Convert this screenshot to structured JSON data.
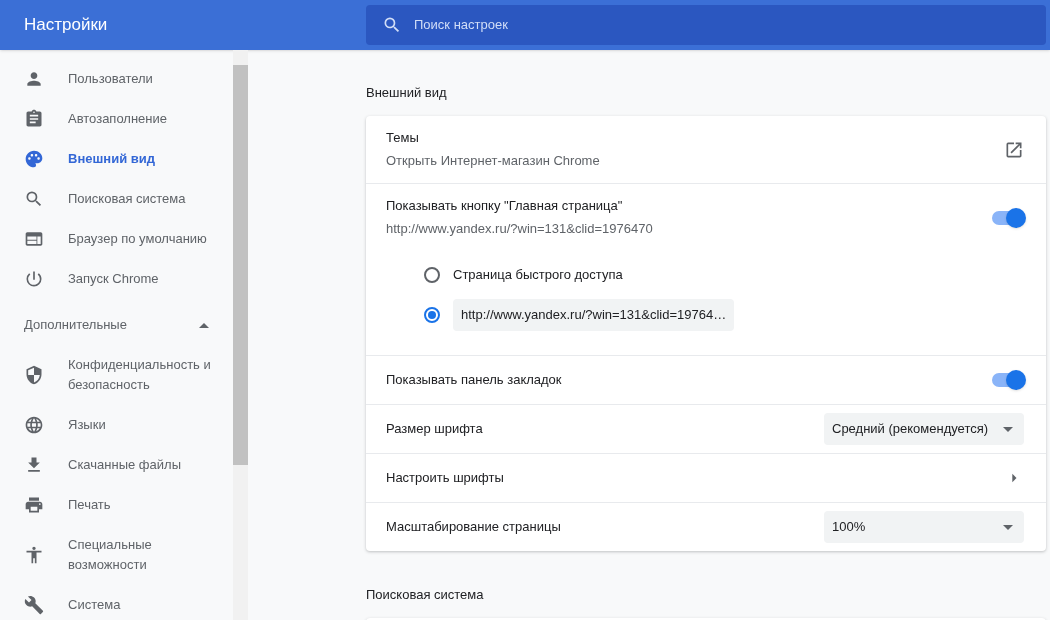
{
  "header": {
    "title": "Настройки",
    "search": {
      "placeholder": "Поиск настроек"
    }
  },
  "sidebar": {
    "items": [
      {
        "label": "Пользователи",
        "selected": false
      },
      {
        "label": "Автозаполнение",
        "selected": false
      },
      {
        "label": "Внешний вид",
        "selected": true
      },
      {
        "label": "Поисковая система",
        "selected": false
      },
      {
        "label": "Браузер по умолчанию",
        "selected": false
      },
      {
        "label": "Запуск Chrome",
        "selected": false
      }
    ],
    "advanced": {
      "label": "Дополнительные",
      "expanded": true,
      "items": [
        {
          "label": "Конфиденциальность и безопасность",
          "selected": false
        },
        {
          "label": "Языки",
          "selected": false
        },
        {
          "label": "Скачанные файлы",
          "selected": false
        },
        {
          "label": "Печать",
          "selected": false
        },
        {
          "label": "Специальные возможности",
          "selected": false
        },
        {
          "label": "Система",
          "selected": false
        }
      ]
    }
  },
  "sections": [
    {
      "title": "Внешний вид",
      "rows": [
        {
          "kind": "link",
          "label": "Темы",
          "sublabel": "Открыть Интернет-магазин Chrome"
        },
        {
          "kind": "toggle",
          "label": "Показывать кнопку \"Главная страница\"",
          "sublabel": "http://www.yandex.ru/?win=131&clid=1976470",
          "on": true,
          "options": [
            {
              "kind": "text",
              "label": "Страница быстрого доступа",
              "selected": false
            },
            {
              "kind": "field",
              "value": "http://www.yandex.ru/?win=131&clid=19764…",
              "selected": true
            }
          ]
        },
        {
          "kind": "toggle",
          "label": "Показывать панель закладок",
          "on": true
        },
        {
          "kind": "select",
          "label": "Размер шрифта",
          "value": "Средний (рекомендуется)"
        },
        {
          "kind": "arrow",
          "label": "Настроить шрифты"
        },
        {
          "kind": "select",
          "label": "Масштабирование страницы",
          "value": "100%"
        }
      ]
    },
    {
      "title": "Поисковая система"
    }
  ]
}
